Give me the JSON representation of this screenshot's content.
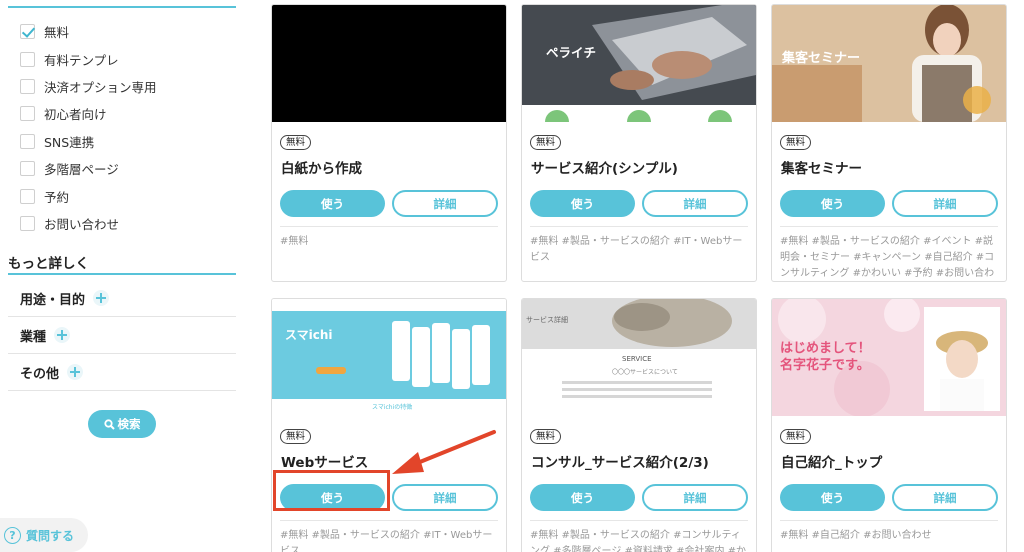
{
  "sidebar": {
    "filters": [
      {
        "label": "無料",
        "checked": true
      },
      {
        "label": "有料テンプレ",
        "checked": false
      },
      {
        "label": "決済オプション専用",
        "checked": false
      },
      {
        "label": "初心者向け",
        "checked": false
      },
      {
        "label": "SNS連携",
        "checked": false
      },
      {
        "label": "多階層ページ",
        "checked": false
      },
      {
        "label": "予約",
        "checked": false
      },
      {
        "label": "お問い合わせ",
        "checked": false
      }
    ],
    "more_title": "もっと詳しく",
    "accordions": [
      {
        "label": "用途・目的"
      },
      {
        "label": "業種"
      },
      {
        "label": "その他"
      }
    ],
    "search_label": "検索",
    "help_label": "質問する"
  },
  "colors": {
    "accent": "#58c3d9",
    "highlight": "#e2452a"
  },
  "cards": [
    {
      "badge": "無料",
      "title": "白紙から作成",
      "use_label": "使う",
      "detail_label": "詳細",
      "tags": "#無料",
      "thumb_text": []
    },
    {
      "badge": "無料",
      "title": "サービス紹介(シンプル)",
      "use_label": "使う",
      "detail_label": "詳細",
      "tags": "#無料 #製品・サービスの紹介 #IT・Webサービス",
      "thumb_text": [
        "ペライチ"
      ]
    },
    {
      "badge": "無料",
      "title": "集客セミナー",
      "use_label": "使う",
      "detail_label": "詳細",
      "tags": "#無料 #製品・サービスの紹介 #イベント #説明会・セミナー #キャンペーン #自己紹介 #コンサルティング #かわいい #予約 #お問い合わせ",
      "thumb_text": [
        "集客セミナー"
      ]
    },
    {
      "badge": "無料",
      "title": "Webサービス",
      "use_label": "使う",
      "detail_label": "詳細",
      "tags": "#無料 #製品・サービスの紹介 #IT・Webサービス",
      "thumb_text": [
        "スマichi",
        "スマichiの特徴"
      ]
    },
    {
      "badge": "無料",
      "title": "コンサル_サービス紹介(2/3)",
      "use_label": "使う",
      "detail_label": "詳細",
      "tags": "#無料 #製品・サービスの紹介 #コンサルティング #多階層ページ #資料請求 #会社案内 #かわい",
      "thumb_text": [
        "サービス詳細",
        "SERVICE",
        "〇〇〇サービスについて"
      ]
    },
    {
      "badge": "無料",
      "title": "自己紹介_トップ",
      "use_label": "使う",
      "detail_label": "詳細",
      "tags": "#無料 #自己紹介 #お問い合わせ",
      "thumb_text": [
        "はじめまして！",
        "名字花子です。"
      ]
    }
  ]
}
